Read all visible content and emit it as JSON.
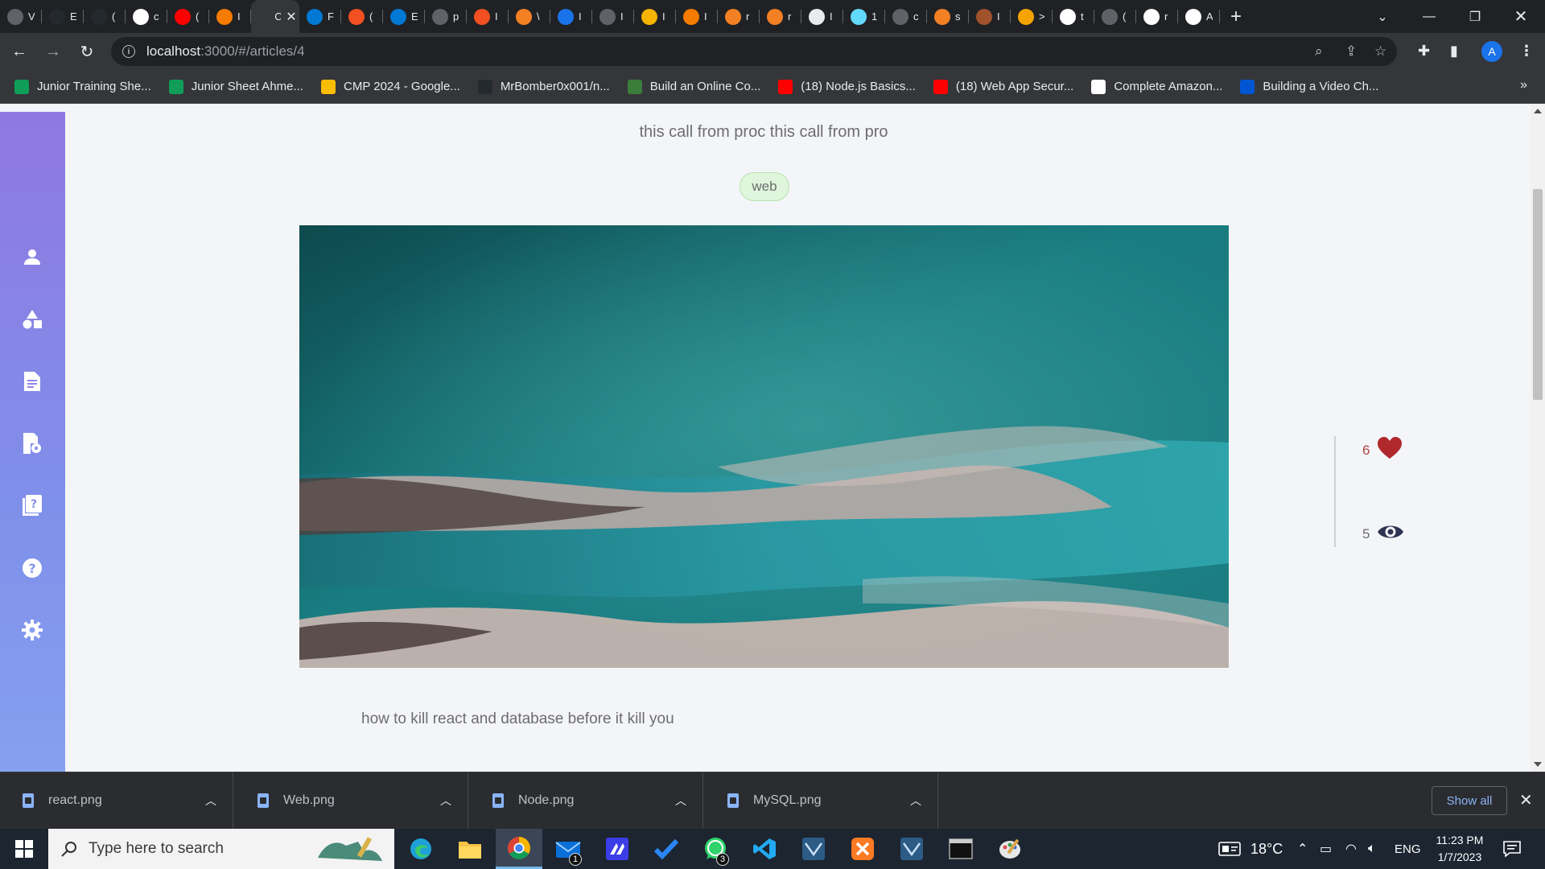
{
  "browser": {
    "tabs": [
      {
        "icon": "chrome-icon",
        "letter": "V",
        "color": "#5f6368"
      },
      {
        "icon": "github-icon",
        "letter": "E",
        "color": "#24292e"
      },
      {
        "icon": "github-icon",
        "letter": "(",
        "color": "#24292e"
      },
      {
        "icon": "google-icon",
        "letter": "c",
        "color": "#ffffff"
      },
      {
        "icon": "youtube-icon",
        "letter": "(",
        "color": "#ff0000"
      },
      {
        "icon": "app-icon",
        "letter": "I",
        "color": "#f57c00"
      },
      {
        "icon": "app-icon",
        "letter": "C",
        "color": "#35363a",
        "active": true
      },
      {
        "icon": "azure-icon",
        "letter": "F",
        "color": "#0078d4"
      },
      {
        "icon": "microsoft-icon",
        "letter": "(",
        "color": "#f25022"
      },
      {
        "icon": "azure-icon",
        "letter": "E",
        "color": "#0078d4"
      },
      {
        "icon": "chrome-icon",
        "letter": "p",
        "color": "#5f6368"
      },
      {
        "icon": "microsoft-icon",
        "letter": "I",
        "color": "#f25022"
      },
      {
        "icon": "stackoverflow-icon",
        "letter": "\\",
        "color": "#f48024"
      },
      {
        "icon": "app-icon",
        "letter": "I",
        "color": "#1a73e8"
      },
      {
        "icon": "chrome-icon",
        "letter": "I",
        "color": "#5f6368"
      },
      {
        "icon": "app-icon",
        "letter": "I",
        "color": "#f4b400"
      },
      {
        "icon": "app-icon",
        "letter": "I",
        "color": "#f57c00"
      },
      {
        "icon": "stackoverflow-icon",
        "letter": "r",
        "color": "#f48024"
      },
      {
        "icon": "stackoverflow-icon",
        "letter": "r",
        "color": "#f48024"
      },
      {
        "icon": "app-icon",
        "letter": "I",
        "color": "#e8eaed"
      },
      {
        "icon": "react-icon",
        "letter": "1",
        "color": "#61dafb"
      },
      {
        "icon": "chrome-icon",
        "letter": "c",
        "color": "#5f6368"
      },
      {
        "icon": "stackoverflow-icon",
        "letter": "s",
        "color": "#f48024"
      },
      {
        "icon": "app-icon",
        "letter": "I",
        "color": "#a0522d"
      },
      {
        "icon": "app-icon",
        "letter": ">",
        "color": "#f4a300"
      },
      {
        "icon": "google-icon",
        "letter": "t",
        "color": "#ffffff"
      },
      {
        "icon": "chrome-icon",
        "letter": "(",
        "color": "#5f6368"
      },
      {
        "icon": "google-icon",
        "letter": "r",
        "color": "#ffffff"
      },
      {
        "icon": "wikipedia-icon",
        "letter": "A",
        "color": "#ffffff"
      }
    ],
    "url_host": "localhost",
    "url_path": ":3000/#/articles/4",
    "profile_letter": "A",
    "bookmarks": [
      {
        "label": "Junior Training She...",
        "icon": "sheets-icon",
        "color": "#0f9d58"
      },
      {
        "label": "Junior Sheet Ahme...",
        "icon": "sheets-icon",
        "color": "#0f9d58"
      },
      {
        "label": "CMP 2024 - Google...",
        "icon": "drive-icon",
        "color": "#fbbc04"
      },
      {
        "label": "MrBomber0x001/n...",
        "icon": "github-icon",
        "color": "#24292e"
      },
      {
        "label": "Build an Online Co...",
        "icon": "link-icon",
        "color": "#3c7d3c"
      },
      {
        "label": "(18) Node.js Basics...",
        "icon": "youtube-icon",
        "color": "#ff0000"
      },
      {
        "label": "(18) Web App Secur...",
        "icon": "youtube-icon",
        "color": "#ff0000"
      },
      {
        "label": "Complete Amazon...",
        "icon": "amazon-icon",
        "color": "#ffffff"
      },
      {
        "label": "Building a Video Ch...",
        "icon": "coursera-icon",
        "color": "#0056d2"
      }
    ]
  },
  "page": {
    "subtitle": "this call from proc this call from pro",
    "tag": "web",
    "likes": "6",
    "views": "5",
    "body": "how to kill react and database before it kill you",
    "sidebar_icons": [
      "user-icon",
      "shapes-icon",
      "document-icon",
      "document-settings-icon",
      "help-book-icon",
      "help-icon",
      "settings-icon"
    ]
  },
  "downloads": {
    "items": [
      "react.png",
      "Web.png",
      "Node.png",
      "MySQL.png"
    ],
    "show_all": "Show all"
  },
  "taskbar": {
    "search_placeholder": "Type here to search",
    "weather": "18°C",
    "language": "ENG",
    "time": "11:23 PM",
    "date": "1/7/2023",
    "badges": {
      "mail": "1",
      "whatsapp": "3"
    }
  }
}
